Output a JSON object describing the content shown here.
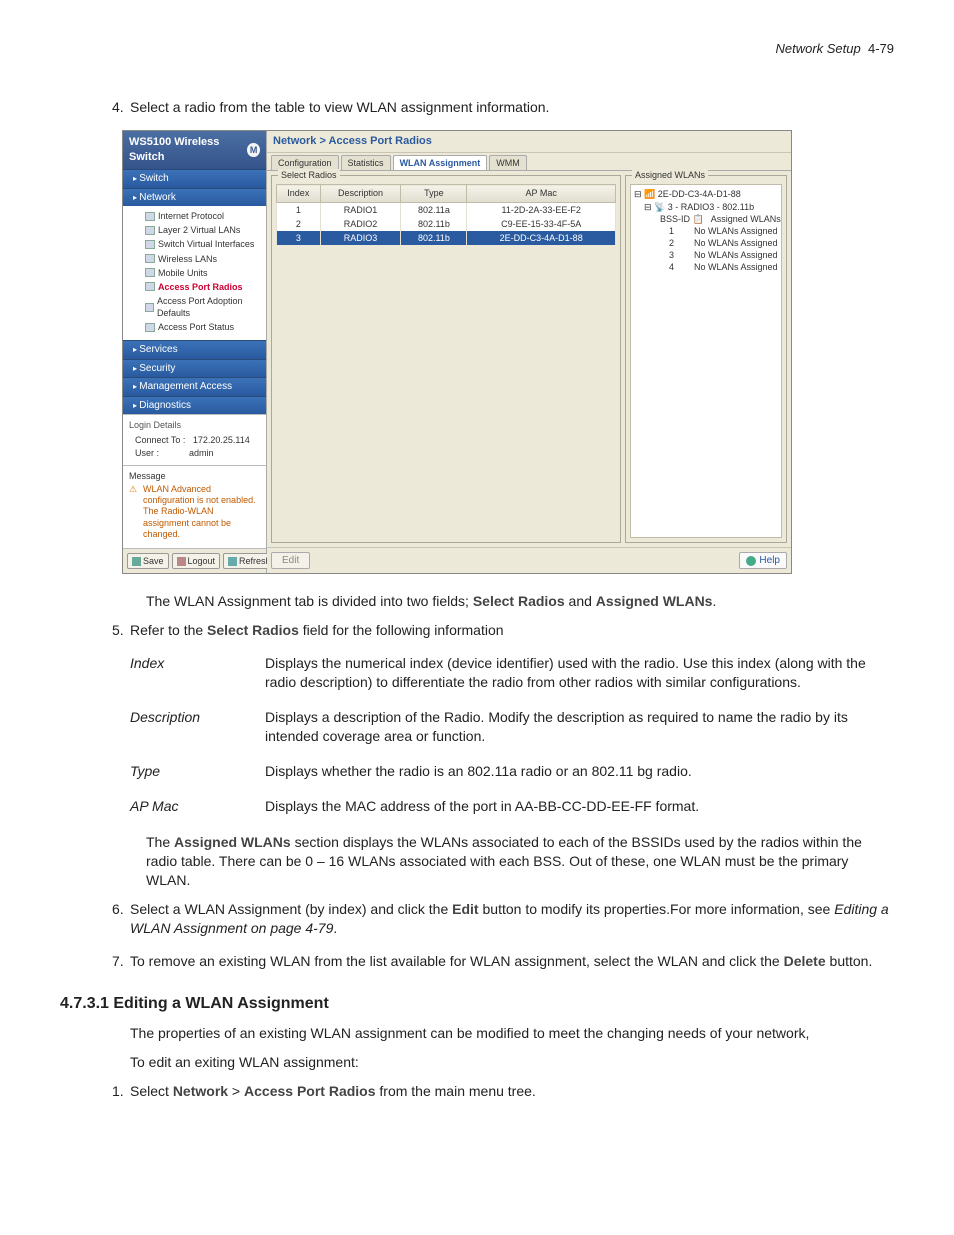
{
  "page_header": {
    "section": "Network Setup",
    "page": "4-79"
  },
  "steps_a": {
    "s4": {
      "num": "4.",
      "text": "Select a radio from the table to view WLAN assignment information."
    },
    "s5_intro": "The WLAN Assignment tab is divided into two fields; ",
    "s5_link1": "Select Radios",
    "s5_and": " and ",
    "s5_link2": "Assigned WLANs",
    "s5_period": ".",
    "s5": {
      "num": "5.",
      "pre": "Refer to the ",
      "link": "Select Radios",
      "post": " field for the following information"
    }
  },
  "definitions": [
    {
      "term": "Index",
      "desc": "Displays the numerical index (device identifier) used with the radio. Use this index (along with the radio description) to differentiate the radio from other radios with similar configurations."
    },
    {
      "term": "Description",
      "desc": "Displays a description of the Radio. Modify the description as required to name the radio by its intended coverage area or function."
    },
    {
      "term": "Type",
      "desc": "Displays whether the radio is an 802.11a radio or an 802.11 bg radio."
    },
    {
      "term": "AP Mac",
      "desc": "Displays the MAC address of the port in AA-BB-CC-DD-EE-FF format."
    }
  ],
  "para_assigned": {
    "pre": "The ",
    "link": "Assigned WLANs",
    "post": " section displays the WLANs associated to each of the BSSIDs used by the radios within the radio table. There can be 0 – 16 WLANs associated with each BSS. Out of these, one WLAN must be the primary WLAN."
  },
  "steps_b": {
    "s6": {
      "num": "6.",
      "pre": "Select a WLAN Assignment (by index) and click the ",
      "link": "Edit",
      "mid": " button to modify its properties.For more information, see ",
      "italic": "Editing a WLAN Assignment on page 4-79",
      "post": "."
    },
    "s7": {
      "num": "7.",
      "pre": "To remove an existing WLAN from the list available for WLAN assignment, select the WLAN and click the ",
      "link": "Delete",
      "post": " button."
    }
  },
  "heading": "4.7.3.1  Editing a WLAN Assignment",
  "sec_p1": "The properties of an existing WLAN assignment can be modified to meet the changing needs of your network,",
  "sec_p2": "To edit an exiting WLAN assignment:",
  "sec_step1": {
    "num": "1.",
    "pre": "Select ",
    "l1": "Network",
    "gt": " > ",
    "l2": "Access Port Radios",
    "post": " from the main menu tree."
  },
  "ui": {
    "title": "WS5100 Wireless Switch",
    "nav": {
      "switch": "Switch",
      "network": "Network",
      "items": [
        "Internet Protocol",
        "Layer 2 Virtual LANs",
        "Switch Virtual Interfaces",
        "Wireless LANs",
        "Mobile Units",
        "Access Port Radios",
        "Access Port Adoption Defaults",
        "Access Port Status"
      ],
      "services": "Services",
      "security": "Security",
      "mgmt": "Management Access",
      "diag": "Diagnostics"
    },
    "login": {
      "title": "Login Details",
      "connect_lbl": "Connect To :",
      "connect_val": "172.20.25.114",
      "user_lbl": "User :",
      "user_val": "admin"
    },
    "message": {
      "title": "Message",
      "text": "WLAN Advanced configuration is not enabled. The Radio-WLAN assignment cannot be changed."
    },
    "buttons": {
      "save": "Save",
      "logout": "Logout",
      "refresh": "Refresh"
    },
    "breadcrumb": "Network > Access Port Radios",
    "tabs": [
      "Configuration",
      "Statistics",
      "WLAN Assignment",
      "WMM"
    ],
    "group_radios": "Select Radios",
    "group_assigned": "Assigned WLANs",
    "table": {
      "headers": [
        "Index",
        "Description",
        "Type",
        "AP Mac"
      ],
      "rows": [
        {
          "idx": "1",
          "desc": "RADIO1",
          "type": "802.11a",
          "mac": "11-2D-2A-33-EE-F2",
          "sel": false
        },
        {
          "idx": "2",
          "desc": "RADIO2",
          "type": "802.11b",
          "mac": "C9-EE-15-33-4F-5A",
          "sel": false
        },
        {
          "idx": "3",
          "desc": "RADIO3",
          "type": "802.11b",
          "mac": "2E-DD-C3-4A-D1-88",
          "sel": true
        }
      ]
    },
    "assigned_tree": {
      "root": "2E-DD-C3-4A-D1-88",
      "sub": "3 - RADIO3 - 802.11b",
      "header_bss": "BSS-ID",
      "header_asgn": "Assigned WLANs",
      "rows": [
        {
          "id": "1",
          "val": "No WLANs Assigned"
        },
        {
          "id": "2",
          "val": "No WLANs Assigned"
        },
        {
          "id": "3",
          "val": "No WLANs Assigned"
        },
        {
          "id": "4",
          "val": "No WLANs Assigned"
        }
      ]
    },
    "footer": {
      "edit": "Edit",
      "help": "Help"
    }
  }
}
